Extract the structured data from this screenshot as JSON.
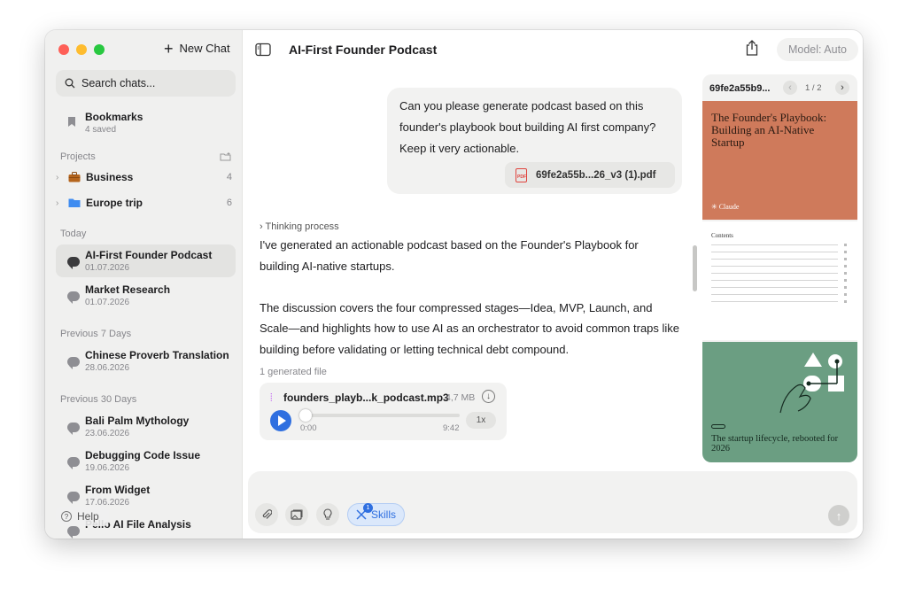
{
  "sidebar": {
    "new_chat": "New Chat",
    "search_placeholder": "Search chats...",
    "bookmarks": {
      "title": "Bookmarks",
      "sub": "4 saved"
    },
    "projects_label": "Projects",
    "projects": [
      {
        "name": "Business",
        "count": "4"
      },
      {
        "name": "Europe trip",
        "count": "6"
      }
    ],
    "sections": [
      {
        "label": "Today",
        "chats": [
          {
            "title": "AI-First Founder Podcast",
            "date": "01.07.2026"
          },
          {
            "title": "Market Research",
            "date": "01.07.2026"
          }
        ]
      },
      {
        "label": "Previous 7 Days",
        "chats": [
          {
            "title": "Chinese Proverb Translation",
            "date": "28.06.2026"
          }
        ]
      },
      {
        "label": "Previous 30 Days",
        "chats": [
          {
            "title": "Bali Palm Mythology",
            "date": "23.06.2026"
          },
          {
            "title": "Debugging Code Issue",
            "date": "19.06.2026"
          },
          {
            "title": "From Widget",
            "date": "17.06.2026"
          },
          {
            "title": "Pello AI File Analysis",
            "date": ""
          }
        ]
      }
    ],
    "help": "Help"
  },
  "header": {
    "title": "AI-First Founder Podcast",
    "model": "Model: Auto"
  },
  "conversation": {
    "user_message": "Can you please generate podcast based on this founder's playbook bout building AI first company? Keep it very actionable.",
    "attachment": "69fe2a55b...26_v3 (1).pdf",
    "thinking": "Thinking process",
    "reply_p1": "I've generated an actionable podcast based on the Founder's Playbook for building AI-native startups.",
    "reply_p2": "The discussion covers the four compressed stages—Idea, MVP, Launch, and Scale—and highlights how to use AI as an orchestrator to avoid common traps like building before validating or letting technical debt compound.",
    "generated_label": "1 generated file",
    "audio": {
      "filename": "founders_playb...k_podcast.mp3",
      "size": "4,7 MB",
      "current": "0:00",
      "duration": "9:42",
      "speed": "1x",
      "progress": 0
    }
  },
  "doc_preview": {
    "name": "69fe2a55b9...",
    "page": "1 / 2",
    "page1_title": "The Founder's Playbook: Building an AI-Native Startup",
    "page1_brand": "Claude",
    "page2_title": "Contents",
    "page3_title": "The startup lifecycle, rebooted for 2026"
  },
  "composer": {
    "skills_label": "Skills",
    "skills_count": "1"
  },
  "colors": {
    "accent": "#2f6fe0",
    "page1_bg": "#cf7a5b",
    "page3_bg": "#6b9e82",
    "pdf_red": "#e0443e"
  }
}
